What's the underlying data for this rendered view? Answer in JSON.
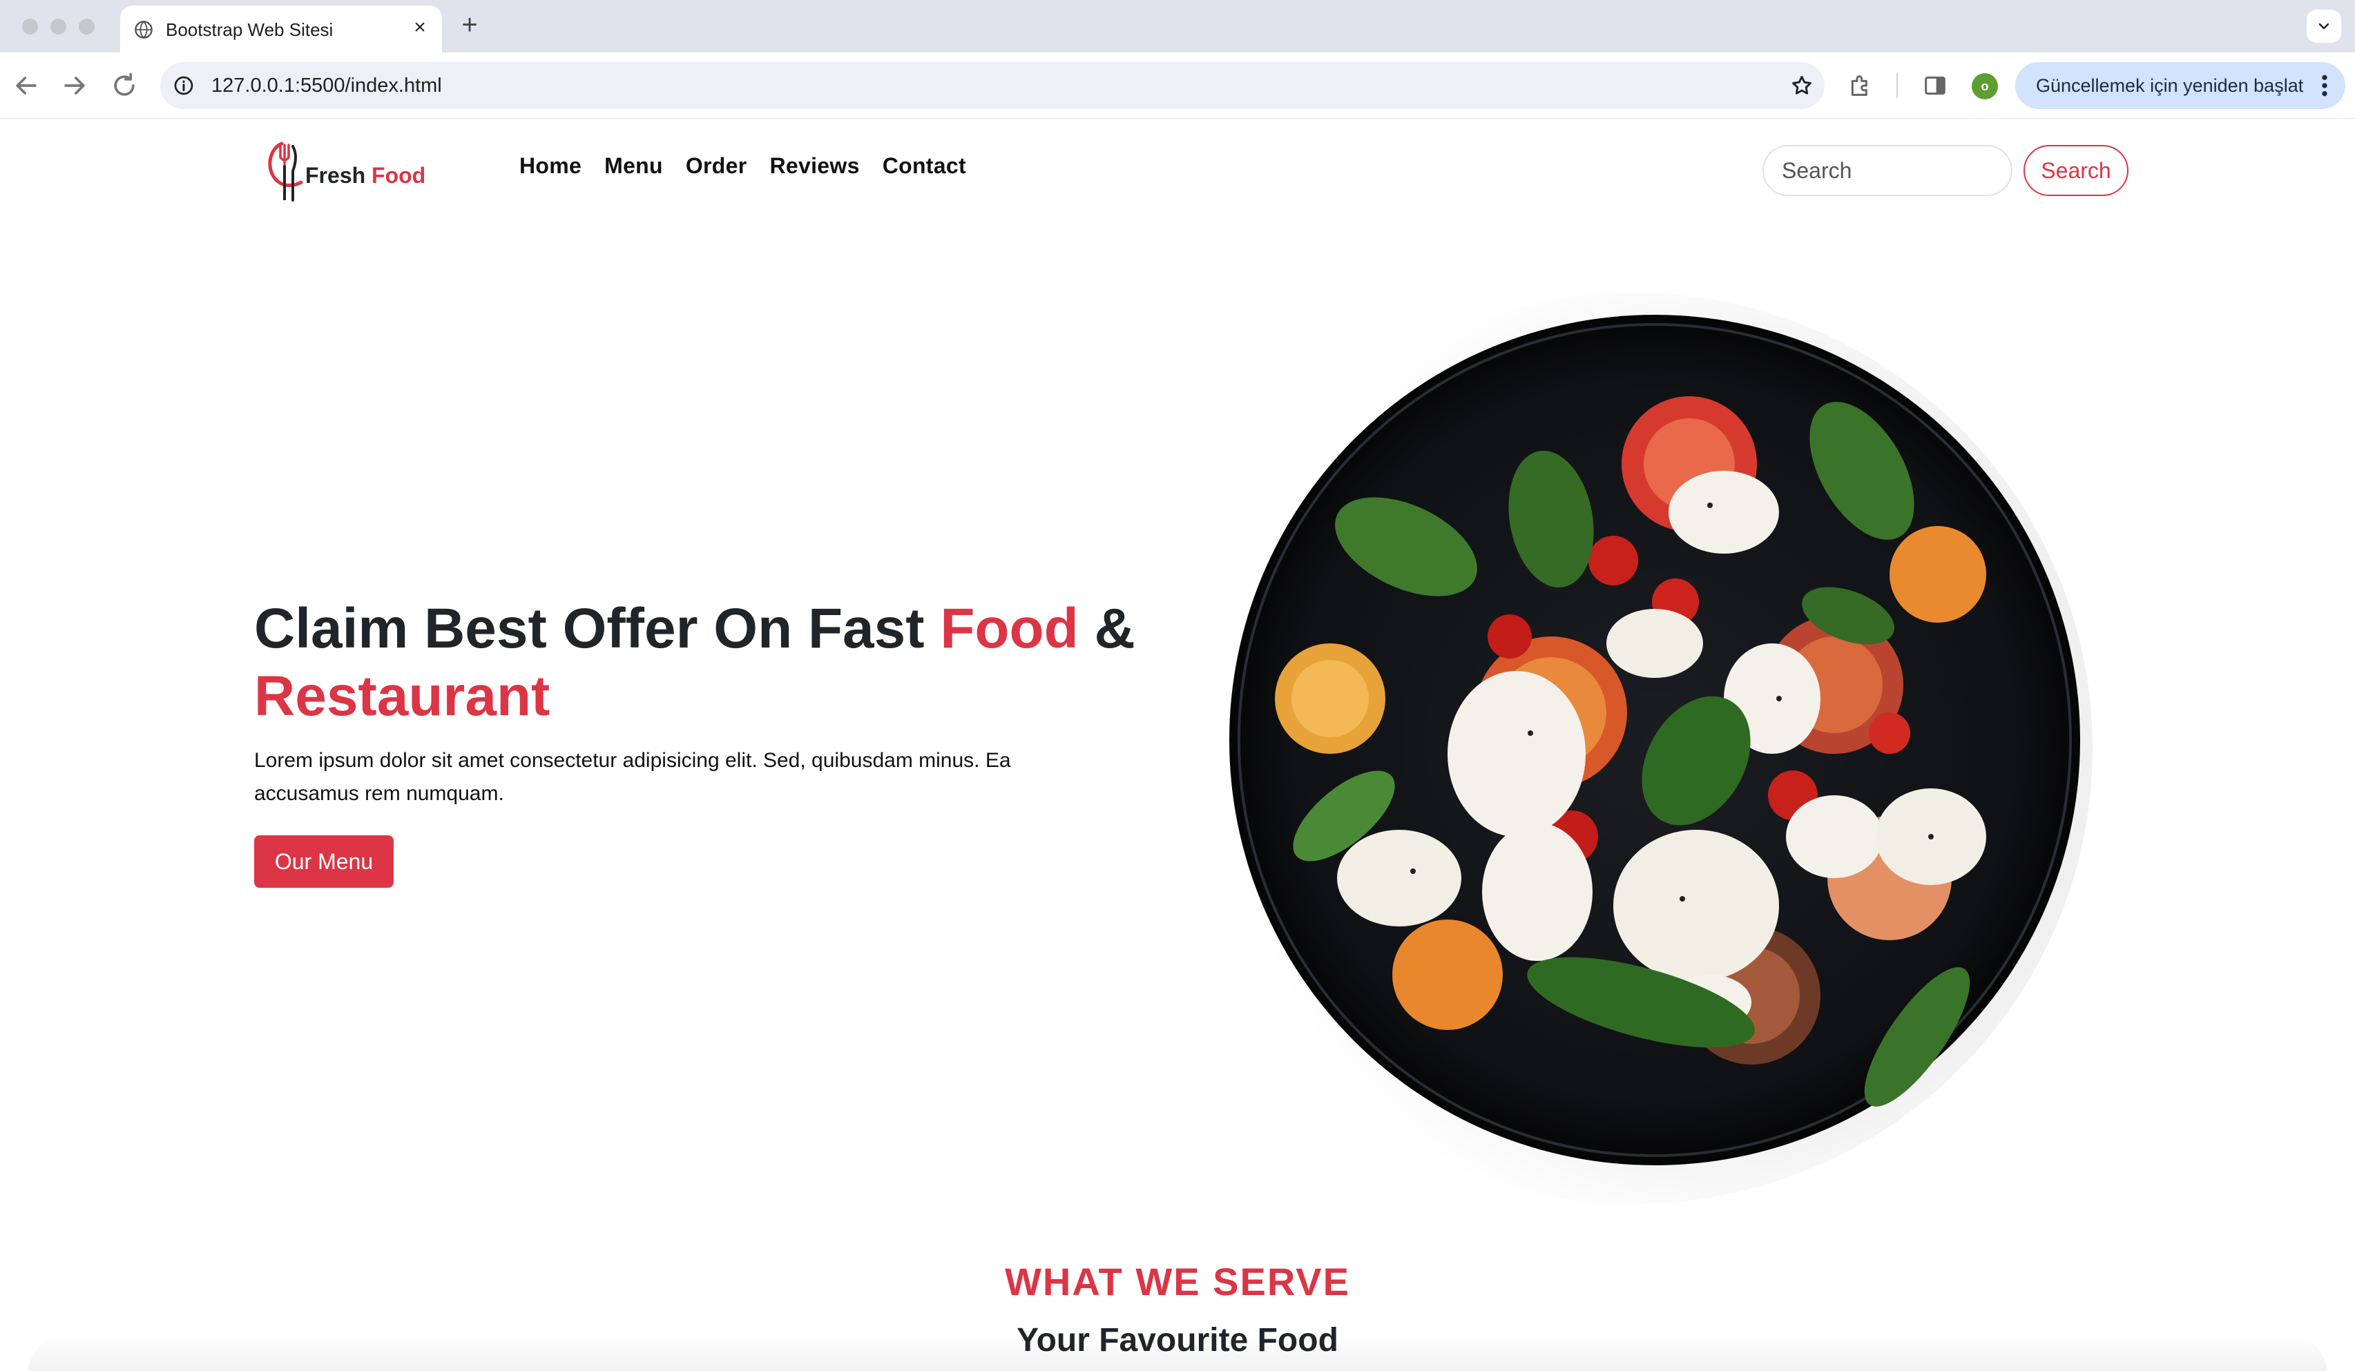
{
  "browser": {
    "tab_title": "Bootstrap Web Sitesi",
    "tab_close": "×",
    "new_tab": "+",
    "url": "127.0.0.1:5500/index.html",
    "profile_initial": "o",
    "restart_label": "Güncellemek için yeniden başlat"
  },
  "site": {
    "logo_fresh": "Fresh",
    "logo_food": "Food",
    "nav": [
      "Home",
      "Menu",
      "Order",
      "Reviews",
      "Contact"
    ],
    "search_placeholder": "Search",
    "search_button": "Search"
  },
  "hero": {
    "title_part1": "Claim Best Offer On Fast ",
    "title_accent1": "Food",
    "title_part2": " & ",
    "title_accent2": "Restaurant",
    "description": "Lorem ipsum dolor sit amet consectetur adipisicing elit. Sed, quibusdam minus. Ea accusamus rem numquam.",
    "button": "Our Menu"
  },
  "section": {
    "label": "WHAT WE SERVE",
    "subtitle": "Your Favourite Food"
  },
  "colors": {
    "accent": "#dc3545",
    "text": "#212529",
    "chrome": "#dfe3eb"
  },
  "icons": {
    "tab_favicon": "globe-icon",
    "back": "arrow-left-icon",
    "forward": "arrow-right-icon",
    "reload": "reload-icon",
    "site_info": "info-icon",
    "bookmark": "star-icon",
    "extensions": "puzzle-icon",
    "side_panel": "side-panel-icon",
    "menu": "kebab-icon"
  }
}
